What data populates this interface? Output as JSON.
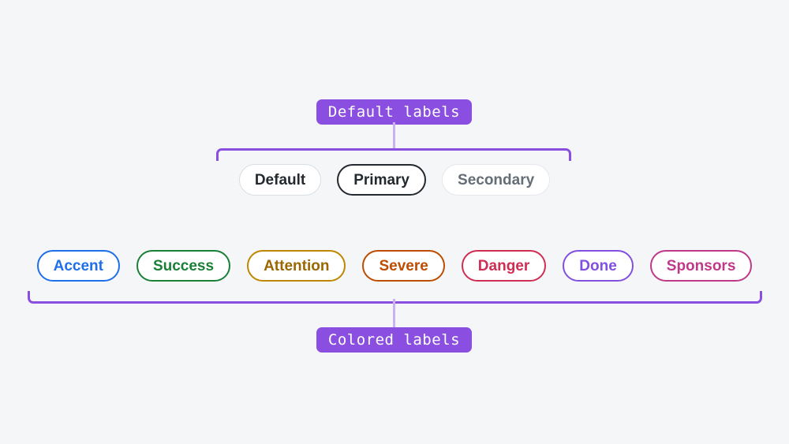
{
  "canvas": {
    "background": "#f5f6f8",
    "accent_purple": "#8a4fe0",
    "stem_purple": "#cbb0f2"
  },
  "annotations": {
    "top_badge": "Default labels",
    "bottom_badge": "Colored labels"
  },
  "groups": [
    {
      "name": "default-labels",
      "badge": "Default labels",
      "labels": [
        {
          "text": "Default",
          "variant": "default",
          "border_color": "#d8dee4",
          "text_color": "#24292f",
          "background": "#ffffff",
          "border_width": "1px"
        },
        {
          "text": "Primary",
          "variant": "primary",
          "border_color": "#24292f",
          "text_color": "#24292f",
          "background": "#ffffff",
          "border_width": "2px"
        },
        {
          "text": "Secondary",
          "variant": "secondary",
          "border_color": "#e4e8ec",
          "text_color": "#656d76",
          "background": "#ffffff",
          "border_width": "1px"
        }
      ]
    },
    {
      "name": "colored-labels",
      "badge": "Colored labels",
      "labels": [
        {
          "text": "Accent",
          "variant": "accent",
          "border_color": "#1f6feb",
          "text_color": "#1f6feb",
          "background": "#ffffff",
          "border_width": "2px"
        },
        {
          "text": "Success",
          "variant": "success",
          "border_color": "#1a7f37",
          "text_color": "#1a7f37",
          "background": "#ffffff",
          "border_width": "2px"
        },
        {
          "text": "Attention",
          "variant": "attention",
          "border_color": "#bf8700",
          "text_color": "#9a6700",
          "background": "#ffffff",
          "border_width": "2px"
        },
        {
          "text": "Severe",
          "variant": "severe",
          "border_color": "#bc4c00",
          "text_color": "#bc4c00",
          "background": "#ffffff",
          "border_width": "2px"
        },
        {
          "text": "Danger",
          "variant": "danger",
          "border_color": "#cf2e53",
          "text_color": "#cf2e53",
          "background": "#ffffff",
          "border_width": "2px"
        },
        {
          "text": "Done",
          "variant": "done",
          "border_color": "#8250df",
          "text_color": "#8250df",
          "background": "#ffffff",
          "border_width": "2px"
        },
        {
          "text": "Sponsors",
          "variant": "sponsors",
          "border_color": "#bf3989",
          "text_color": "#bf3989",
          "background": "#ffffff",
          "border_width": "2px"
        }
      ]
    }
  ]
}
